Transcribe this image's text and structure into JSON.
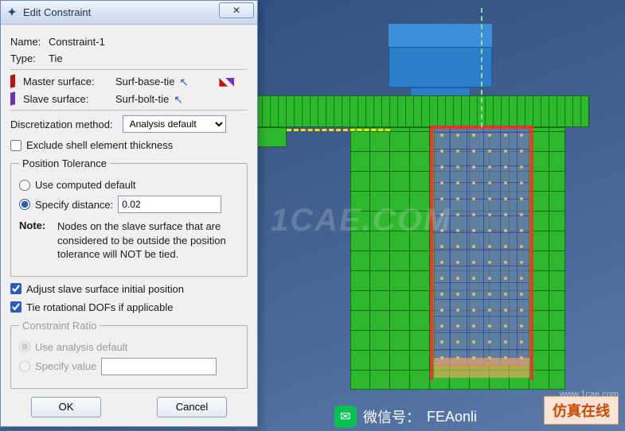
{
  "dialog": {
    "title": "Edit Constraint",
    "name_label": "Name:",
    "name_value": "Constraint-1",
    "type_label": "Type:",
    "type_value": "Tie",
    "master_label": "Master surface:",
    "master_value": "Surf-base-tie",
    "slave_label": "Slave surface:",
    "slave_value": "Surf-bolt-tie",
    "discretization_label": "Discretization method:",
    "discretization_value": "Analysis default",
    "exclude_shell_label": "Exclude shell element thickness",
    "position_tolerance_legend": "Position Tolerance",
    "use_computed_label": "Use computed default",
    "specify_distance_label": "Specify distance:",
    "specify_distance_value": "0.02",
    "note_label": "Note:",
    "note_text": "Nodes on the slave surface that are considered to be outside the position tolerance will NOT be tied.",
    "adjust_slave_label": "Adjust slave surface initial position",
    "tie_rot_label": "Tie rotational DOFs if applicable",
    "constraint_ratio_legend": "Constraint Ratio",
    "use_analysis_default_label": "Use analysis default",
    "specify_value_label": "Specify value",
    "ok_label": "OK",
    "cancel_label": "Cancel"
  },
  "state": {
    "exclude_shell_checked": false,
    "position_option": "specify",
    "adjust_slave_checked": true,
    "tie_rot_checked": true,
    "constraint_ratio_option": "default",
    "constraint_ratio_enabled": false
  },
  "watermarks": {
    "center": "1CAE.COM",
    "badge": "仿真在线",
    "url": "www.1cae.com",
    "wechat_prefix": "微信号：",
    "wechat_handle": "FEAonli"
  }
}
